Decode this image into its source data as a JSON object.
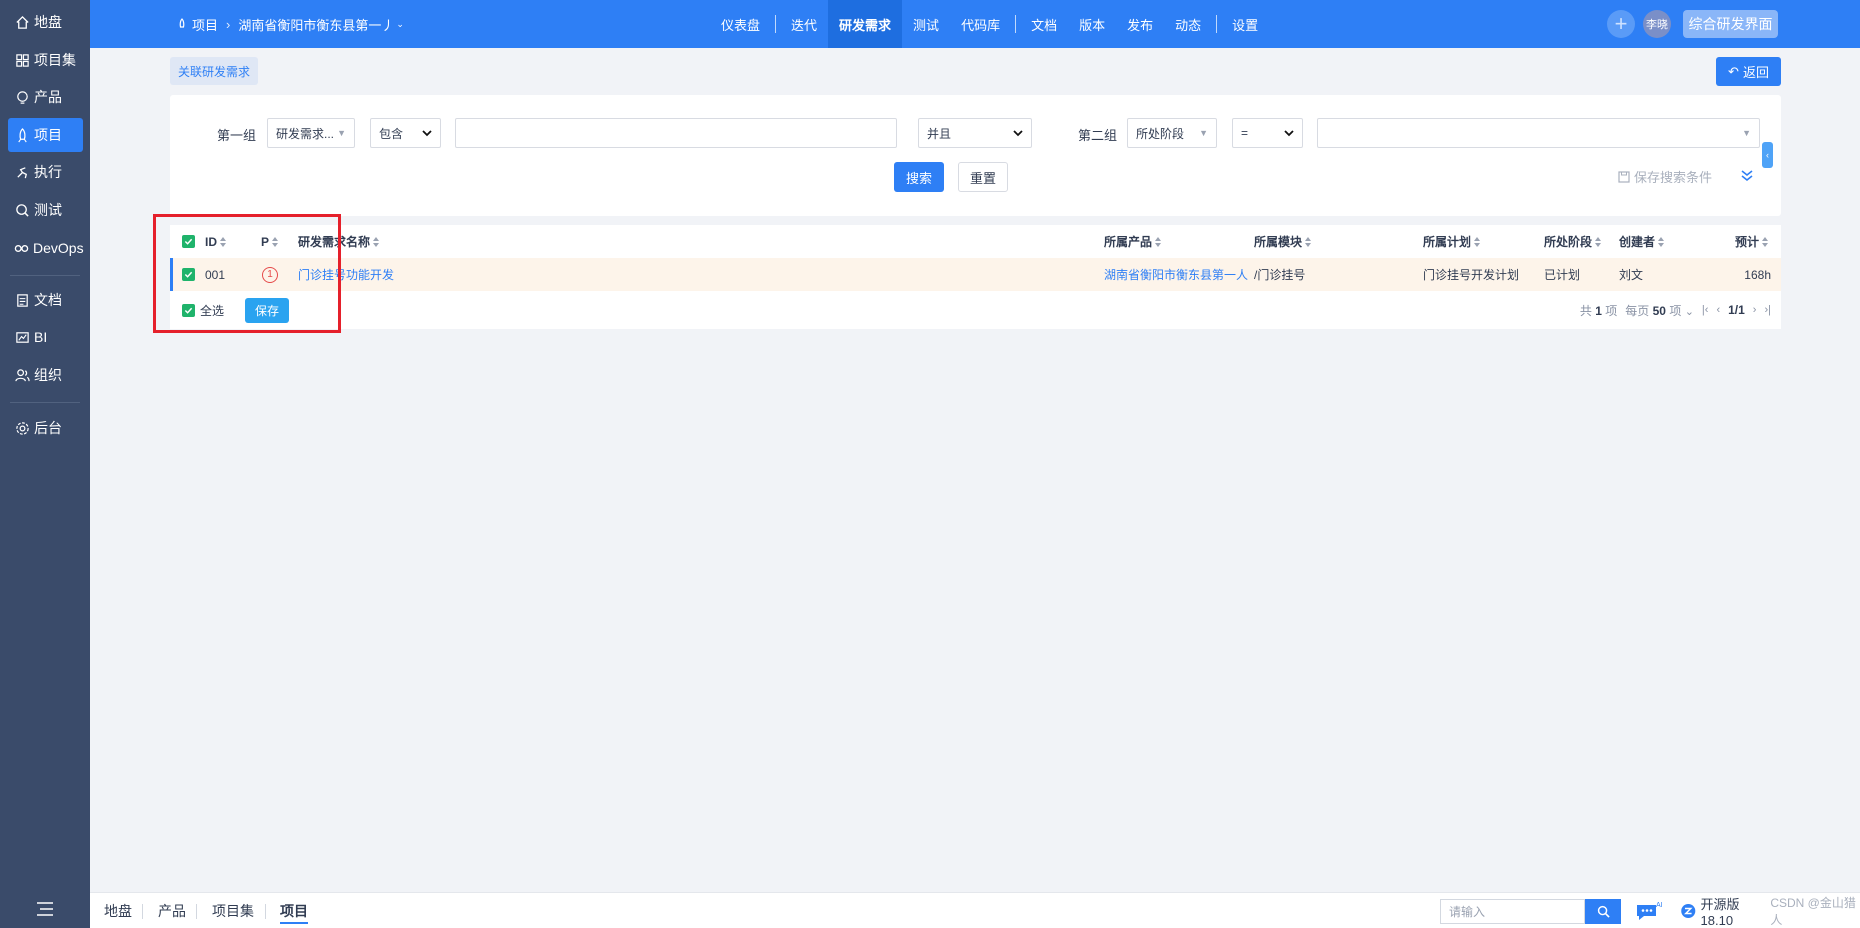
{
  "sidebar": {
    "items": [
      {
        "label": "地盘",
        "icon": "home-icon"
      },
      {
        "label": "项目集",
        "icon": "grid-icon"
      },
      {
        "label": "产品",
        "icon": "lightbulb-icon"
      },
      {
        "label": "项目",
        "icon": "rocket-icon",
        "active": true
      },
      {
        "label": "执行",
        "icon": "run-icon"
      },
      {
        "label": "测试",
        "icon": "bug-search-icon"
      },
      {
        "label": "DevOps",
        "icon": "infinity-icon"
      },
      {
        "label": "文档",
        "icon": "document-icon"
      },
      {
        "label": "BI",
        "icon": "chart-icon"
      },
      {
        "label": "组织",
        "icon": "people-icon"
      },
      {
        "label": "后台",
        "icon": "gear-icon"
      }
    ]
  },
  "topbar": {
    "breadcrumb": {
      "root": "项目",
      "project": "湖南省衡阳市衡东县第一丿"
    },
    "nav": [
      "仪表盘",
      "迭代",
      "研发需求",
      "测试",
      "代码库",
      "文档",
      "版本",
      "发布",
      "动态",
      "设置"
    ],
    "active_nav": "研发需求",
    "user": "李晓",
    "mode_button": "综合研发界面"
  },
  "subheader": {
    "link_label": "关联研发需求",
    "back_label": "返回"
  },
  "search": {
    "group1_label": "第一组",
    "group1_field": "研发需求...",
    "group1_operator": "包含",
    "group1_value": "",
    "logic": "并且",
    "group2_label": "第二组",
    "group2_field": "所处阶段",
    "group2_operator": "=",
    "group2_value": "",
    "search_button": "搜索",
    "reset_button": "重置",
    "save_condition": "保存搜索条件"
  },
  "table": {
    "columns": [
      "ID",
      "P",
      "研发需求名称",
      "所属产品",
      "所属模块",
      "所属计划",
      "所处阶段",
      "创建者",
      "预计"
    ],
    "rows": [
      {
        "id": "001",
        "priority": "1",
        "name": "门诊挂号功能开发",
        "product": "湖南省衡阳市衡东县第一人",
        "module": "/门诊挂号",
        "plan": "门诊挂号开发计划",
        "stage": "已计划",
        "creator": "刘文",
        "estimate": "168h"
      }
    ],
    "select_all": "全选",
    "save_button": "保存",
    "pager": {
      "total_prefix": "共",
      "total": "1",
      "total_suffix": "项",
      "per_page_prefix": "每页",
      "per_page": "50",
      "per_page_suffix": "项",
      "page": "1/1"
    }
  },
  "bottombar": {
    "tabs": [
      "地盘",
      "产品",
      "项目集",
      "项目"
    ],
    "active_tab": "项目",
    "search_placeholder": "请输入",
    "ai_label": "AI",
    "version": "开源版18.10",
    "watermark": "CSDN @金山猎人"
  },
  "colors": {
    "primary": "#2e7ff5",
    "sidebar": "#3a4b6a",
    "highlight_box": "#e5202b",
    "checkbox": "#1fb36b",
    "priority": "#e64b4b"
  }
}
